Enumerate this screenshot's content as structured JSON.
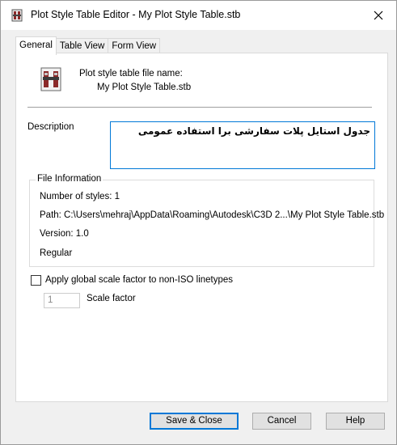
{
  "window": {
    "title": "Plot Style Table Editor - My Plot Style Table.stb",
    "app_icon": "plot-style-table-icon",
    "close_icon": "close-icon"
  },
  "tabs": [
    {
      "label": "General",
      "active": true
    },
    {
      "label": "Table View",
      "active": false
    },
    {
      "label": "Form View",
      "active": false
    }
  ],
  "general": {
    "file_name_label": "Plot style table file name:",
    "file_name": "My Plot Style Table.stb",
    "description_label": "Description",
    "description_value": "جدول استایل پلات سفارشی برا استفاده عمومی",
    "file_info": {
      "title": "File Information",
      "num_styles": "Number of styles: 1",
      "path": "Path: C:\\Users\\mehraj\\AppData\\Roaming\\Autodesk\\C3D 2...\\My Plot Style Table.stb",
      "version": "Version: 1.0",
      "type": "Regular"
    },
    "apply_scale_label": "Apply global scale factor to non-ISO linetypes",
    "apply_scale_checked": false,
    "scale_factor_value": "1",
    "scale_factor_label": "Scale factor"
  },
  "buttons": {
    "save_close": "Save & Close",
    "cancel": "Cancel",
    "help": "Help"
  },
  "colors": {
    "accent": "#0078d7",
    "dialog_bg": "#f0f0f0"
  }
}
